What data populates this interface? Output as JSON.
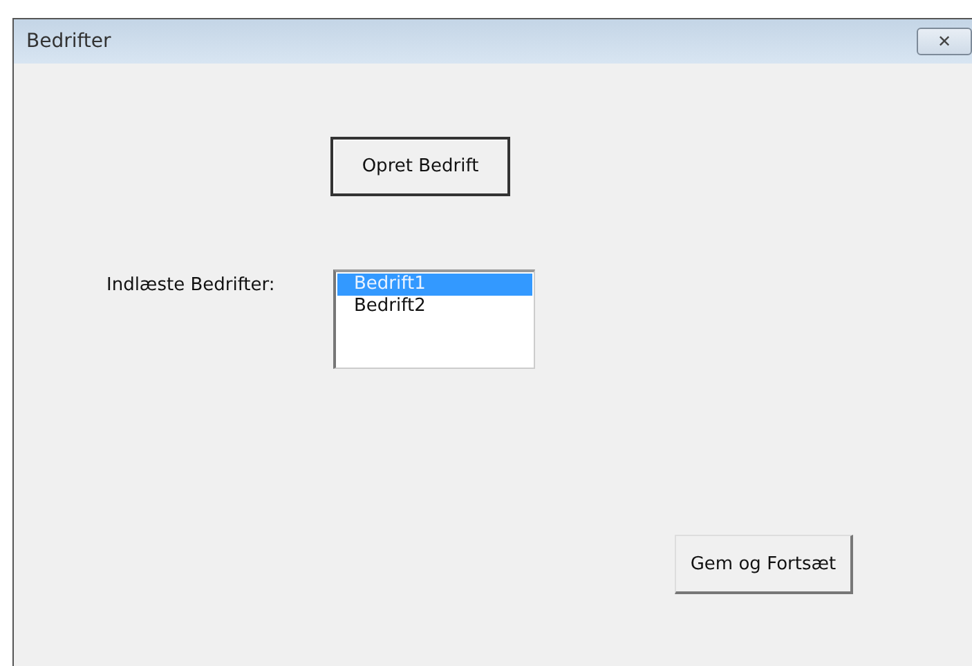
{
  "window": {
    "title": "Bedrifter",
    "close": "✕"
  },
  "create_button": "Opret Bedrift",
  "list_label": "Indlæste Bedrifter:",
  "list_items": [
    {
      "label": "Bedrift1",
      "selected": true
    },
    {
      "label": "Bedrift2",
      "selected": false
    }
  ],
  "save_button": "Gem og Fortsæt"
}
